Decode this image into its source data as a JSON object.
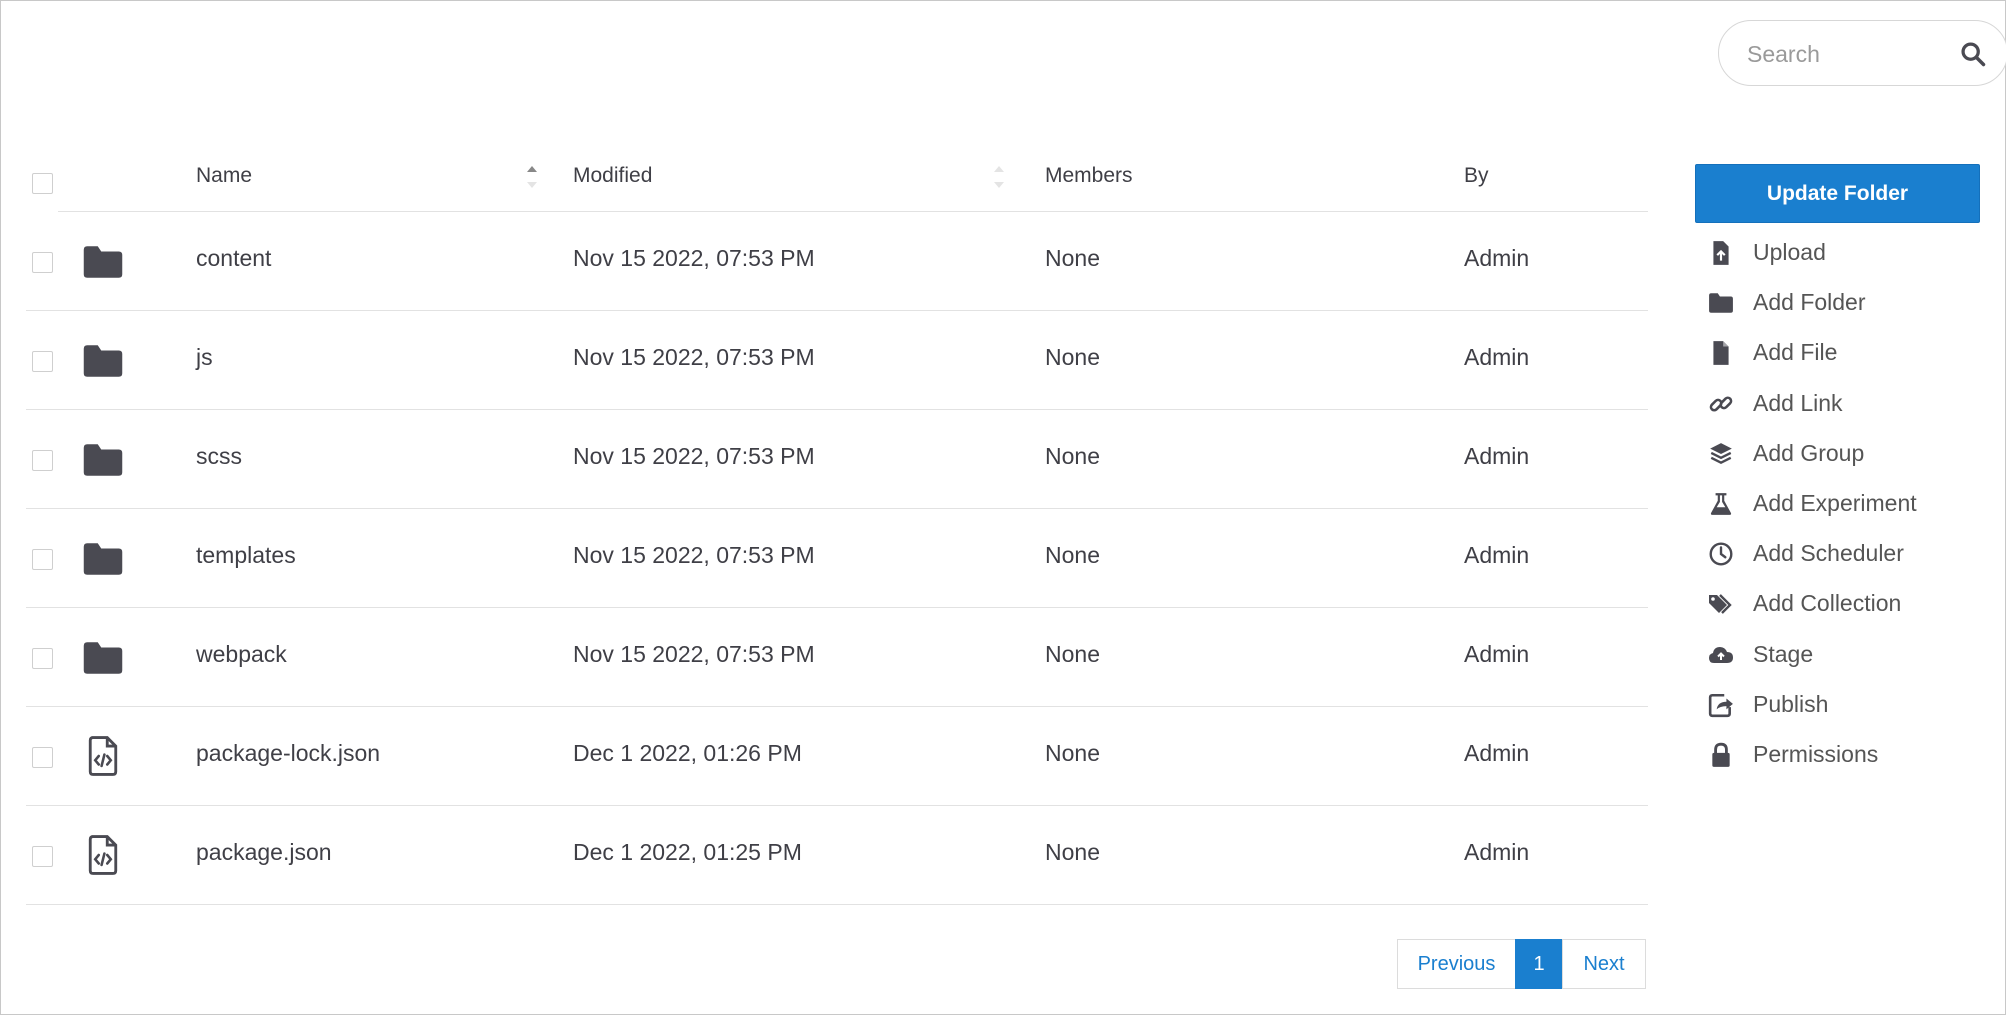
{
  "search": {
    "placeholder": "Search"
  },
  "table": {
    "columns": {
      "name": "Name",
      "modified": "Modified",
      "members": "Members",
      "by": "By"
    },
    "rows": [
      {
        "type": "folder",
        "name": "content",
        "modified": "Nov 15 2022, 07:53 PM",
        "members": "None",
        "by": "Admin"
      },
      {
        "type": "folder",
        "name": "js",
        "modified": "Nov 15 2022, 07:53 PM",
        "members": "None",
        "by": "Admin"
      },
      {
        "type": "folder",
        "name": "scss",
        "modified": "Nov 15 2022, 07:53 PM",
        "members": "None",
        "by": "Admin"
      },
      {
        "type": "folder",
        "name": "templates",
        "modified": "Nov 15 2022, 07:53 PM",
        "members": "None",
        "by": "Admin"
      },
      {
        "type": "folder",
        "name": "webpack",
        "modified": "Nov 15 2022, 07:53 PM",
        "members": "None",
        "by": "Admin"
      },
      {
        "type": "code-file",
        "name": "package-lock.json",
        "modified": "Dec 1 2022, 01:26 PM",
        "members": "None",
        "by": "Admin"
      },
      {
        "type": "code-file",
        "name": "package.json",
        "modified": "Dec 1 2022, 01:25 PM",
        "members": "None",
        "by": "Admin"
      }
    ]
  },
  "panel": {
    "update_button": "Update Folder",
    "actions": [
      {
        "label": "Upload",
        "icon": "upload-file-icon"
      },
      {
        "label": "Add Folder",
        "icon": "folder-icon"
      },
      {
        "label": "Add File",
        "icon": "file-icon"
      },
      {
        "label": "Add Link",
        "icon": "link-icon"
      },
      {
        "label": "Add Group",
        "icon": "layers-icon"
      },
      {
        "label": "Add Experiment",
        "icon": "flask-icon"
      },
      {
        "label": "Add Scheduler",
        "icon": "clock-icon"
      },
      {
        "label": "Add Collection",
        "icon": "tags-icon"
      },
      {
        "label": "Stage",
        "icon": "cloud-upload-icon"
      },
      {
        "label": "Publish",
        "icon": "share-icon"
      },
      {
        "label": "Permissions",
        "icon": "lock-icon"
      }
    ]
  },
  "pagination": {
    "previous": "Previous",
    "current": "1",
    "next": "Next"
  },
  "colors": {
    "accent": "#1a7fcf",
    "icon": "#4a4a52",
    "text": "#3f3f46"
  }
}
